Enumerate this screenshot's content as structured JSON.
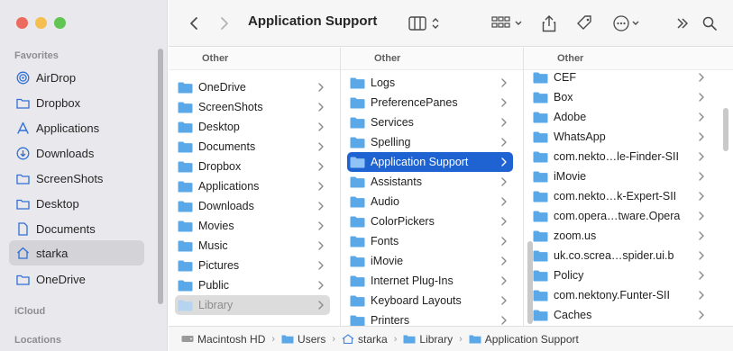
{
  "colors": {
    "accent": "#1e63d1",
    "folder": "#5ba8e8",
    "sidebar_icon": "#2f6fd6"
  },
  "sidebar": {
    "favorites_title": "Favorites",
    "favorites": [
      {
        "label": "AirDrop",
        "icon": "airdrop-icon"
      },
      {
        "label": "Dropbox",
        "icon": "folder-icon"
      },
      {
        "label": "Applications",
        "icon": "applications-icon"
      },
      {
        "label": "Downloads",
        "icon": "downloads-icon"
      },
      {
        "label": "ScreenShots",
        "icon": "folder-icon"
      },
      {
        "label": "Desktop",
        "icon": "desktop-icon"
      },
      {
        "label": "Documents",
        "icon": "document-icon"
      },
      {
        "label": "starka",
        "icon": "home-icon"
      },
      {
        "label": "OneDrive",
        "icon": "folder-icon"
      }
    ],
    "icloud_title": "iCloud",
    "locations_title": "Locations"
  },
  "toolbar": {
    "title": "Application Support",
    "back_icon": "chevron-left-icon",
    "forward_icon": "chevron-right-icon"
  },
  "columns": [
    {
      "header": "Other",
      "items": [
        "OneDrive",
        "ScreenShots",
        "Desktop",
        "Documents",
        "Dropbox",
        "Applications",
        "Downloads",
        "Movies",
        "Music",
        "Pictures",
        "Public",
        "Library"
      ]
    },
    {
      "header": "Other",
      "items": [
        "Logs",
        "PreferencePanes",
        "Services",
        "Spelling",
        "Application Support",
        "Assistants",
        "Audio",
        "ColorPickers",
        "Fonts",
        "iMovie",
        "Internet Plug-Ins",
        "Keyboard Layouts",
        "Printers"
      ]
    },
    {
      "header": "Other",
      "items": [
        "CEF",
        "Box",
        "Adobe",
        "WhatsApp",
        "com.nekto…le-Finder-SII",
        "iMovie",
        "com.nekto…k-Expert-SII",
        "com.opera…tware.Opera",
        "zoom.us",
        "uk.co.screa…spider.ui.b",
        "Policy",
        "com.nektony.Funter-SII",
        "Caches"
      ]
    }
  ],
  "pathbar": [
    "Macintosh HD",
    "Users",
    "starka",
    "Library",
    "Application Support"
  ]
}
